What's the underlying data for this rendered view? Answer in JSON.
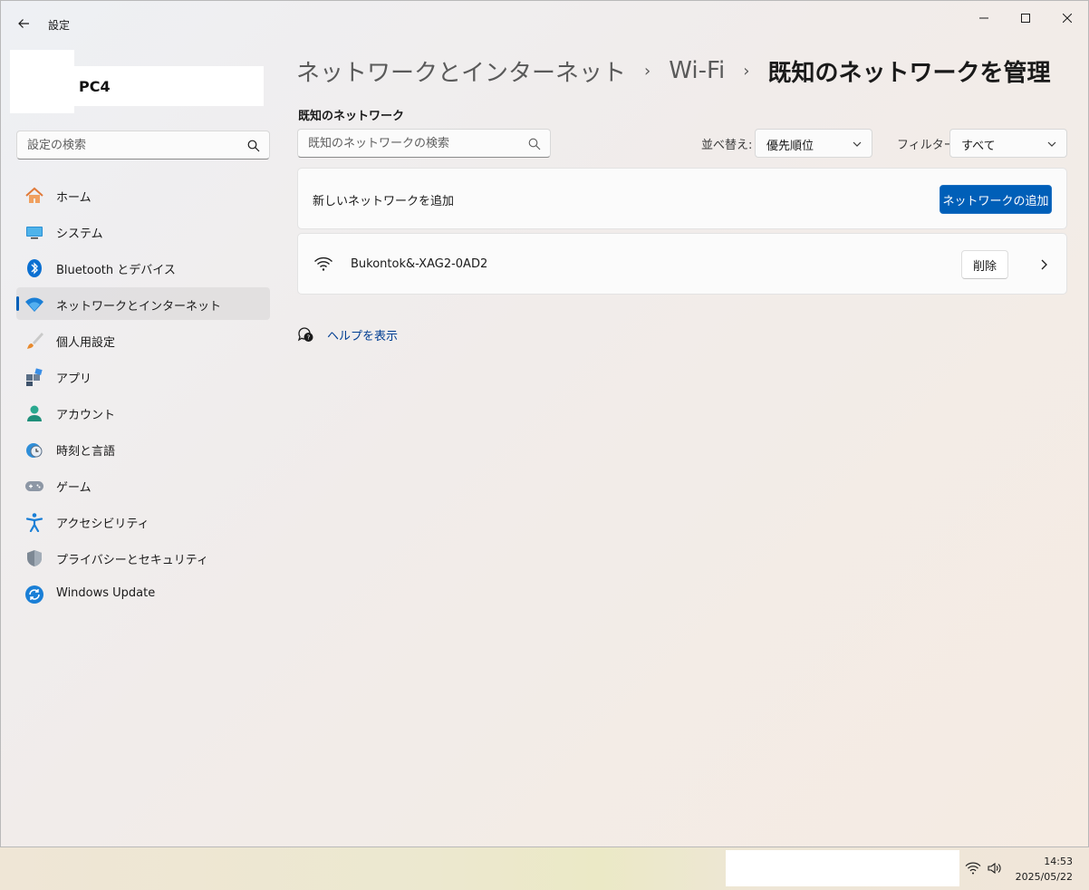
{
  "window": {
    "title": "設定"
  },
  "account": {
    "name": "PC4"
  },
  "sidebar": {
    "search_placeholder": "設定の検索",
    "items": [
      {
        "label": "ホーム",
        "icon": "home-icon",
        "active": false
      },
      {
        "label": "システム",
        "icon": "system-icon",
        "active": false
      },
      {
        "label": "Bluetooth とデバイス",
        "icon": "bluetooth-icon",
        "active": false
      },
      {
        "label": "ネットワークとインターネット",
        "icon": "network-icon",
        "active": true
      },
      {
        "label": "個人用設定",
        "icon": "paintbrush-icon",
        "active": false
      },
      {
        "label": "アプリ",
        "icon": "apps-icon",
        "active": false
      },
      {
        "label": "アカウント",
        "icon": "account-icon",
        "active": false
      },
      {
        "label": "時刻と言語",
        "icon": "time-language-icon",
        "active": false
      },
      {
        "label": "ゲーム",
        "icon": "gamepad-icon",
        "active": false
      },
      {
        "label": "アクセシビリティ",
        "icon": "accessibility-icon",
        "active": false
      },
      {
        "label": "プライバシーとセキュリティ",
        "icon": "shield-icon",
        "active": false
      },
      {
        "label": "Windows Update",
        "icon": "windows-update-icon",
        "active": false
      }
    ]
  },
  "breadcrumb": {
    "items": [
      "ネットワークとインターネット",
      "Wi-Fi"
    ],
    "current": "既知のネットワークを管理",
    "separator": "›"
  },
  "main": {
    "section_title": "既知のネットワーク",
    "search_placeholder": "既知のネットワークの検索",
    "sort": {
      "label": "並べ替え:",
      "value": "優先順位"
    },
    "filter": {
      "label": "フィルター:",
      "value": "すべて"
    },
    "add_network": {
      "label": "新しいネットワークを追加",
      "button": "ネットワークの追加"
    },
    "networks": [
      {
        "name": "Bukontok&-XAG2-0AD2",
        "delete_label": "削除",
        "icon": "wifi-icon"
      }
    ],
    "help_link": "ヘルプを表示"
  },
  "taskbar": {
    "time": "14:53",
    "date": "2025/05/22"
  },
  "colors": {
    "accent": "#005fb8",
    "link": "#003e92"
  }
}
